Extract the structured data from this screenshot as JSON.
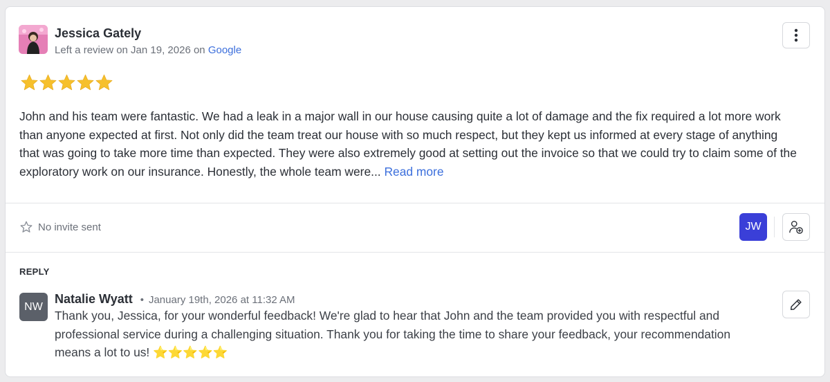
{
  "review": {
    "reviewer_name": "Jessica Gately",
    "meta_prefix": "Left a review on Jan 19, 2026 on",
    "source": "Google",
    "rating": 5,
    "body": "John and his team were fantastic. We had a leak in a major wall in our house causing quite a lot of damage and the fix required a lot more work than anyone expected at first. Not only did the team treat our house with so much respect, but they kept us informed at every stage of anything that was going to take more time than expected. They were also extremely good at setting out the invoice so that we could try to claim some of the exploratory work on our insurance. Honestly, the whole team were...",
    "read_more_label": "Read more"
  },
  "invite": {
    "status_label": "No invite sent"
  },
  "assignee": {
    "initials": "JW"
  },
  "reply": {
    "heading": "REPLY",
    "author_initials": "NW",
    "author_name": "Natalie Wyatt",
    "separator": "•",
    "date": "January 19th, 2026 at 11:32 AM",
    "text": "Thank you, Jessica, for your wonderful feedback! We're glad to hear that John and the team provided you with respectful and professional service during a challenging situation. Thank you for taking the time to share your feedback, your recommendation means a lot to us! ⭐⭐⭐⭐⭐"
  },
  "icons": {
    "menu": "kebab-menu-icon",
    "invite": "star-outline-icon",
    "assign": "add-user-icon",
    "edit": "pencil-icon",
    "rating": "star-icon"
  },
  "colors": {
    "link": "#3c6fdc",
    "star": "#f6c02c",
    "assignee_badge": "#3a3fd8",
    "reply_avatar": "#5b6069"
  }
}
